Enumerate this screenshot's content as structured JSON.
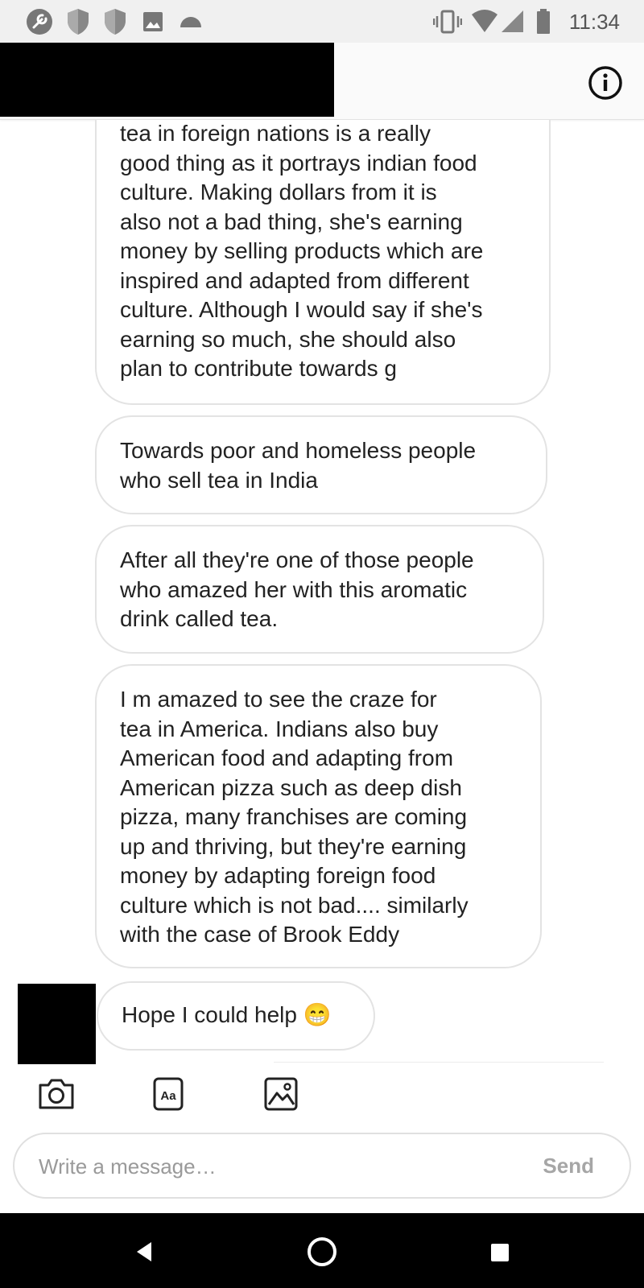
{
  "status_bar": {
    "time": "11:34",
    "left_icons": [
      "tools-icon",
      "shield-icon",
      "shield-icon",
      "image-icon",
      "cloud-icon"
    ],
    "right_icons": [
      "vibrate-icon",
      "wifi-icon",
      "signal-icon",
      "battery-icon"
    ]
  },
  "header": {
    "info_icon": "info-icon"
  },
  "messages": [
    {
      "text": "tea in foreign nations is a really\ngood thing as it portrays indian food\nculture. Making dollars from it is\nalso not a bad thing, she's earning\nmoney by selling products which are\ninspired and adapted from different\nculture. Although I would say if she's\nearning so much, she should also\nplan to contribute towards g"
    },
    {
      "text": "Towards poor and homeless people\nwho sell tea in India"
    },
    {
      "text": "After all they're one of those people\nwho amazed her with this aromatic\ndrink called tea."
    },
    {
      "text": "I m amazed to see the craze for\ntea in America. Indians also buy\nAmerican food and adapting from\nAmerican pizza such as deep dish\npizza, many franchises are coming\nup and thriving, but they're earning\nmoney by adapting foreign food\nculture which is not bad.... similarly\nwith the case of Brook Eddy"
    },
    {
      "text": "Hope I could help 😁"
    }
  ],
  "toolbar": {
    "icons": [
      "camera-icon",
      "text-format-icon",
      "gallery-icon"
    ],
    "text_format_label": "Aa"
  },
  "composer": {
    "placeholder": "Write a message…",
    "send_label": "Send"
  },
  "nav": {
    "icons": [
      "back-icon",
      "home-icon",
      "recents-icon"
    ]
  }
}
